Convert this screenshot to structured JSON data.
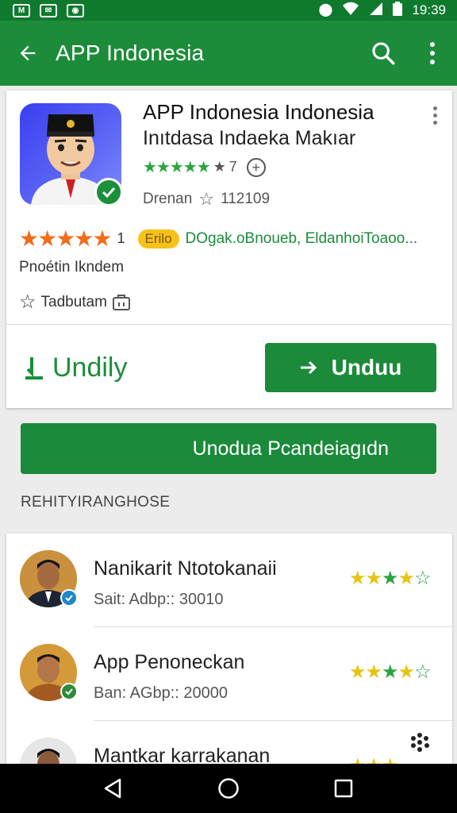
{
  "status_bar": {
    "left_icons": [
      "notification-m-icon",
      "notification-mail-icon",
      "notification-app-icon"
    ],
    "right_icons": [
      "data-icon",
      "wifi-icon",
      "signal-icon",
      "battery-icon"
    ],
    "time": "19:39"
  },
  "app_bar": {
    "title": "APP Indonesia",
    "icons": [
      "back-arrow-icon",
      "search-icon",
      "more-vert-icon"
    ]
  },
  "app_card": {
    "name": "APP Indonesia Indonesia",
    "subtitle": "Inıtdasa Indaeka Makıar",
    "green_rating_text": "7",
    "developer": "Drenan",
    "star_count": "112109",
    "orange_rating_count": "1",
    "badge": "Erilo",
    "info_line": "DOgak.oBnoueb, EldanhoiToaoo...",
    "production_text": "Pnoétin Ikndem",
    "tag_text": "Tadbutam",
    "secondary_action": "Undily",
    "primary_action": "Unduu"
  },
  "wide_button": {
    "label": "Unodua Pcandeiagıdn"
  },
  "section_label": "REHITYIRANGHOSE",
  "list": [
    {
      "name": "Nanikarit Ntotokanaii",
      "meta": "Sait: Adbp:: 30010",
      "stars_full": 3,
      "stars_half": true,
      "badge_color": "#1e88c9"
    },
    {
      "name": "App Penoneckan",
      "meta": "Ban: AGbp:: 20000",
      "stars_full": 3,
      "stars_half": true,
      "badge_color": "#2e8b3a"
    },
    {
      "name": "Mantkar karrakanan",
      "meta": "",
      "stars_full": 3,
      "stars_half": false,
      "badge_color": ""
    }
  ],
  "colors": {
    "status_bar": "#0f7a2e",
    "app_bar": "#1c8c3a",
    "button": "#1b8a3a",
    "star_green": "#2aa43f",
    "star_orange": "#f26c1a",
    "star_yellow": "#e5c414",
    "badge_yellow": "#f6c21a"
  }
}
